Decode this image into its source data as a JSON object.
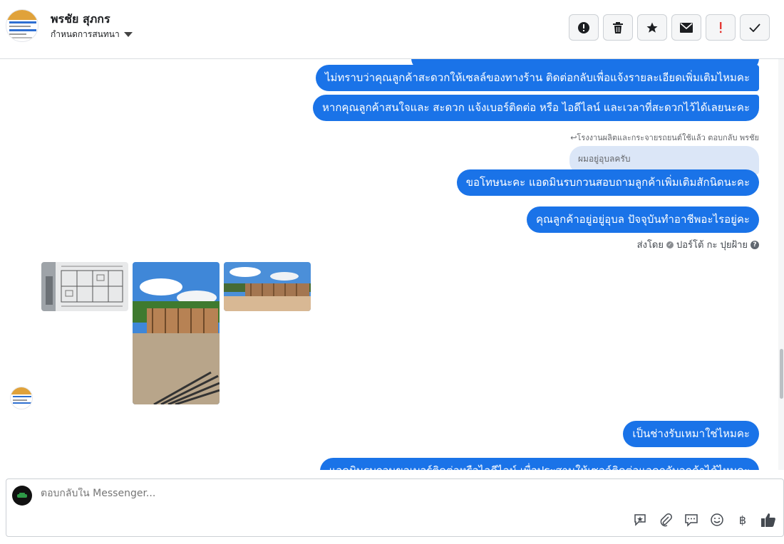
{
  "header": {
    "name": "พรชัย สุภกร",
    "subtitle": "กำหนดการสนทนา",
    "actions": [
      {
        "icon": "alert-circle-icon"
      },
      {
        "icon": "trash-icon"
      },
      {
        "icon": "star-icon"
      },
      {
        "icon": "envelope-icon"
      },
      {
        "icon": "exclamation-icon",
        "color": "#e53935"
      },
      {
        "icon": "checkmark-icon"
      }
    ]
  },
  "messages": [
    {
      "text": "ไม่ทราบว่าคุณลูกค้าสะดวกให้เซลล์ของทางร้าน ติดต่อกลับเพื่อแจ้งรายละเอียดเพิ่มเติมไหมคะ"
    },
    {
      "text": "หากคุณลูกค้าสนใจและ สะดวก แจ้งเบอร์ติดต่อ หรือ ไอดีไลน์ และเวลาที่สะดวกไว้ได้เลยนะคะ"
    },
    {
      "text": "ขอโทษนะคะ แอดมินรบกวนสอบถามลูกค้าเพิ่มเติมสักนิดนะคะ"
    },
    {
      "text": "คุณลูกค้าอยู่อยู่อุบล ปัจจุบันทำอาชีพอะไรอยู่คะ"
    },
    {
      "text": "เป็นช่างรับเหมาใช่ไหมคะ"
    },
    {
      "text": "แอดมินรบกวนขอเบอร์ติดต่อหรือไอดีไลน์ เพื่อประสานให้เซลล์ติดต่อแอดกลับลูกค้าได้ไหมคะ"
    }
  ],
  "reply_note": "↩โรงงานผลิตและกระจายรถยนต์ใช้แล้ว ตอบกลับ พรชัย",
  "quoted": "ผมอยู่อุบลครับ",
  "sent_by": {
    "prefix": "ส่งโดย",
    "name": "ปอร์โต้ กะ ปุยฝ้าย",
    "help": "?"
  },
  "composer": {
    "placeholder": "ตอบกลับใน Messenger...",
    "tools": [
      {
        "icon": "sticker-chat-icon"
      },
      {
        "icon": "paperclip-icon"
      },
      {
        "icon": "chat-bubble-icon"
      },
      {
        "icon": "smiley-icon"
      },
      {
        "icon": "baht-icon",
        "glyph": "฿"
      },
      {
        "icon": "thumbs-up-icon"
      }
    ]
  },
  "colors": {
    "bubble": "#1a73e8",
    "quoted_bg": "#dbe6f7",
    "accent_red": "#e53935"
  }
}
